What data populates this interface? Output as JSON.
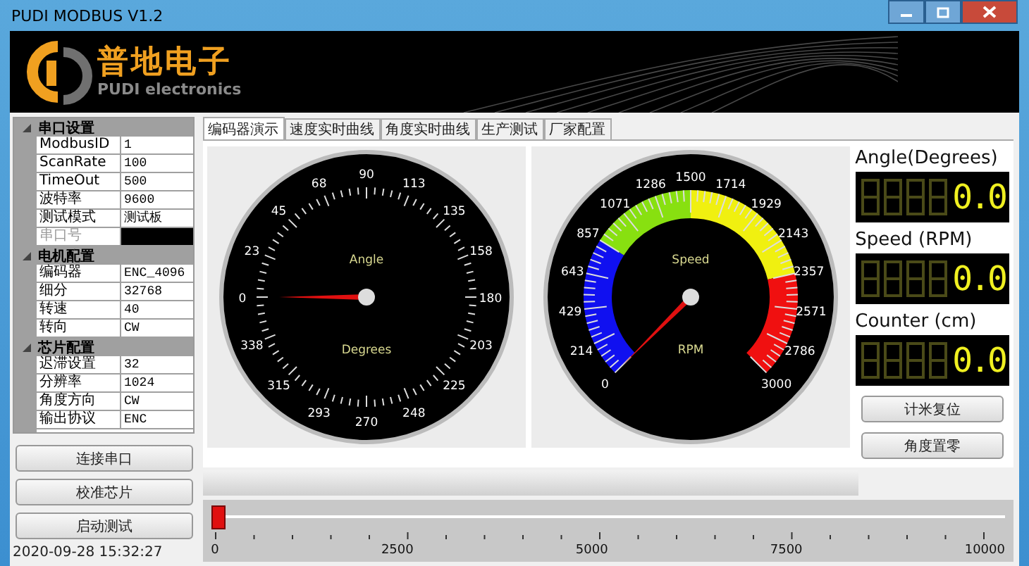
{
  "window": {
    "title": "PUDI MODBUS V1.2"
  },
  "banner": {
    "brand_cn": "普地电子",
    "brand_en": "PUDI electronics"
  },
  "property_groups": [
    {
      "title": "串口设置",
      "expanded": true,
      "rows": [
        {
          "label": "ModbusID",
          "value": "1",
          "disabled": false
        },
        {
          "label": "ScanRate",
          "value": "100",
          "disabled": false
        },
        {
          "label": "TimeOut",
          "value": "500",
          "disabled": false
        },
        {
          "label": "波特率",
          "value": "9600",
          "disabled": false
        },
        {
          "label": "测试模式",
          "value": "测试板",
          "disabled": false
        },
        {
          "label": "串口号",
          "disabled": true
        }
      ]
    },
    {
      "title": "电机配置",
      "expanded": true,
      "rows": [
        {
          "label": "编码器",
          "value": "ENC_4096",
          "disabled": false
        },
        {
          "label": "细分",
          "value": "32768",
          "disabled": false
        },
        {
          "label": "转速",
          "value": "40",
          "disabled": false
        },
        {
          "label": "转向",
          "value": "CW",
          "disabled": false
        }
      ]
    },
    {
      "title": "芯片配置",
      "expanded": true,
      "rows": [
        {
          "label": "迟滞设置",
          "value": "32",
          "disabled": false
        },
        {
          "label": "分辨率",
          "value": "1024",
          "disabled": false
        },
        {
          "label": "角度方向",
          "value": "CW",
          "disabled": false
        },
        {
          "label": "输出协议",
          "value": "ENC",
          "disabled": false
        }
      ]
    }
  ],
  "side_buttons": [
    "连接串口",
    "校准芯片",
    "启动测试"
  ],
  "status_bar": {
    "timestamp": "2020-09-28 15:32:27"
  },
  "tabs": [
    {
      "label": "编码器演示",
      "selected": true
    },
    {
      "label": "速度实时曲线",
      "selected": false
    },
    {
      "label": "角度实时曲线",
      "selected": false
    },
    {
      "label": "生产测试",
      "selected": false
    },
    {
      "label": "厂家配置",
      "selected": false
    }
  ],
  "gauges": [
    {
      "kind": "angle",
      "caption": "Angle",
      "unit": "Degrees",
      "scale": [
        "0",
        "23",
        "45",
        "68",
        "90",
        "113",
        "135",
        "158",
        "180",
        "203",
        "225",
        "248",
        "270",
        "293",
        "315",
        "338"
      ]
    },
    {
      "kind": "speed",
      "caption": "Speed",
      "unit": "RPM",
      "scale": [
        "0",
        "214",
        "429",
        "643",
        "857",
        "1071",
        "1286",
        "1500",
        "1714",
        "1929",
        "2143",
        "2357",
        "2571",
        "2786",
        "3000"
      ]
    }
  ],
  "readouts": [
    {
      "title": "Angle(Degrees)",
      "value": "0.0"
    },
    {
      "title": "Speed (RPM)",
      "value": "0.0"
    },
    {
      "title": "Counter (cm)",
      "value": "0.0"
    }
  ],
  "action_buttons": [
    "计米复位",
    "角度置零"
  ],
  "slider": {
    "level": 0,
    "ticks": [
      "0",
      "2500",
      "5000",
      "7500",
      "10000"
    ]
  }
}
